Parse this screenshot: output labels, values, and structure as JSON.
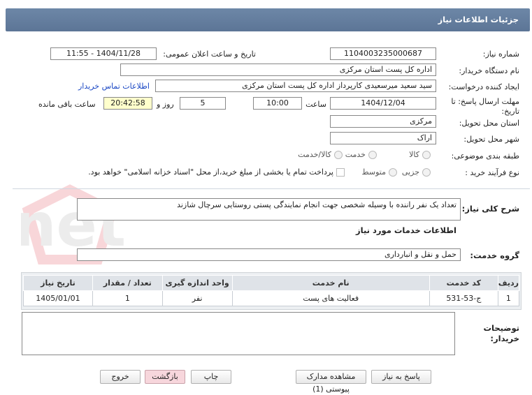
{
  "header": {
    "title": "جزئیات اطلاعات نیاز"
  },
  "fields": {
    "need_number_label": "شماره نیاز:",
    "need_number": "1104003235000687",
    "announce_label": "تاریخ و ساعت اعلان عمومی:",
    "announce_value": "1404/11/28 - 11:55",
    "buyer_org_label": "نام دستگاه خریدار:",
    "buyer_org": "اداره کل پست استان مرکزی",
    "requester_label": "ایجاد کننده درخواست:",
    "requester": "سید سعید میرسعیدی کارپرداز اداره کل پست استان مرکزی",
    "contact_link": "اطلاعات تماس خریدار",
    "deadline_label_1": "مهلت ارسال پاسخ: تا",
    "deadline_label_2": "تاریخ:",
    "deadline_date": "1404/12/04",
    "time_label": "ساعت",
    "deadline_time": "10:00",
    "days_value": "5",
    "days_label": "روز و",
    "remaining_time": "20:42:58",
    "remaining_label": "ساعت باقی مانده",
    "province_label": "استان محل تحویل:",
    "province": "مرکزی",
    "city_label": "شهر محل تحویل:",
    "city": "اراک",
    "category_label": "طبقه بندی موضوعی:",
    "category_options": [
      "کالا",
      "خدمت",
      "کالا/خدمت"
    ],
    "process_label": "نوع فرآیند خرید :",
    "process_options": [
      "جزیی",
      "متوسط"
    ],
    "payment_note": "پرداخت تمام یا بخشی از مبلغ خرید،از محل \"اسناد خزانه اسلامی\" خواهد بود."
  },
  "description": {
    "label": "شرح کلی نیاز:",
    "value": "تعداد یک نفر راننده با وسیله شخصی جهت انجام نمایندگی پستی روستایی  سرچال شازند"
  },
  "services_title": "اطلاعات خدمات مورد نیاز",
  "service_group": {
    "label": "گروه خدمت:",
    "value": "حمل و نقل و انبارداری"
  },
  "table": {
    "headers": [
      "ردیف",
      "کد خدمت",
      "نام خدمت",
      "واحد اندازه گیری",
      "تعداد / مقدار",
      "تاریخ نیاز"
    ],
    "rows": [
      [
        "1",
        "ج-53-531",
        "فعالیت های پست",
        "نفر",
        "1",
        "1405/01/01"
      ]
    ]
  },
  "buyer_notes": {
    "label_1": "توضیحات",
    "label_2": "خریدار:",
    "value": ""
  },
  "buttons": {
    "reply": "پاسخ به نیاز",
    "attachments": "مشاهده مدارک پیوستی (1)",
    "print": "چاپ",
    "back": "بازگشت",
    "exit": "خروج"
  },
  "watermark": {
    "text": "AriaTender.net"
  },
  "colors": {
    "header": "#6d87a7",
    "link": "#1a47c4",
    "remaining_bg": "#ffffcc",
    "back_button": "#f7d6dc"
  }
}
